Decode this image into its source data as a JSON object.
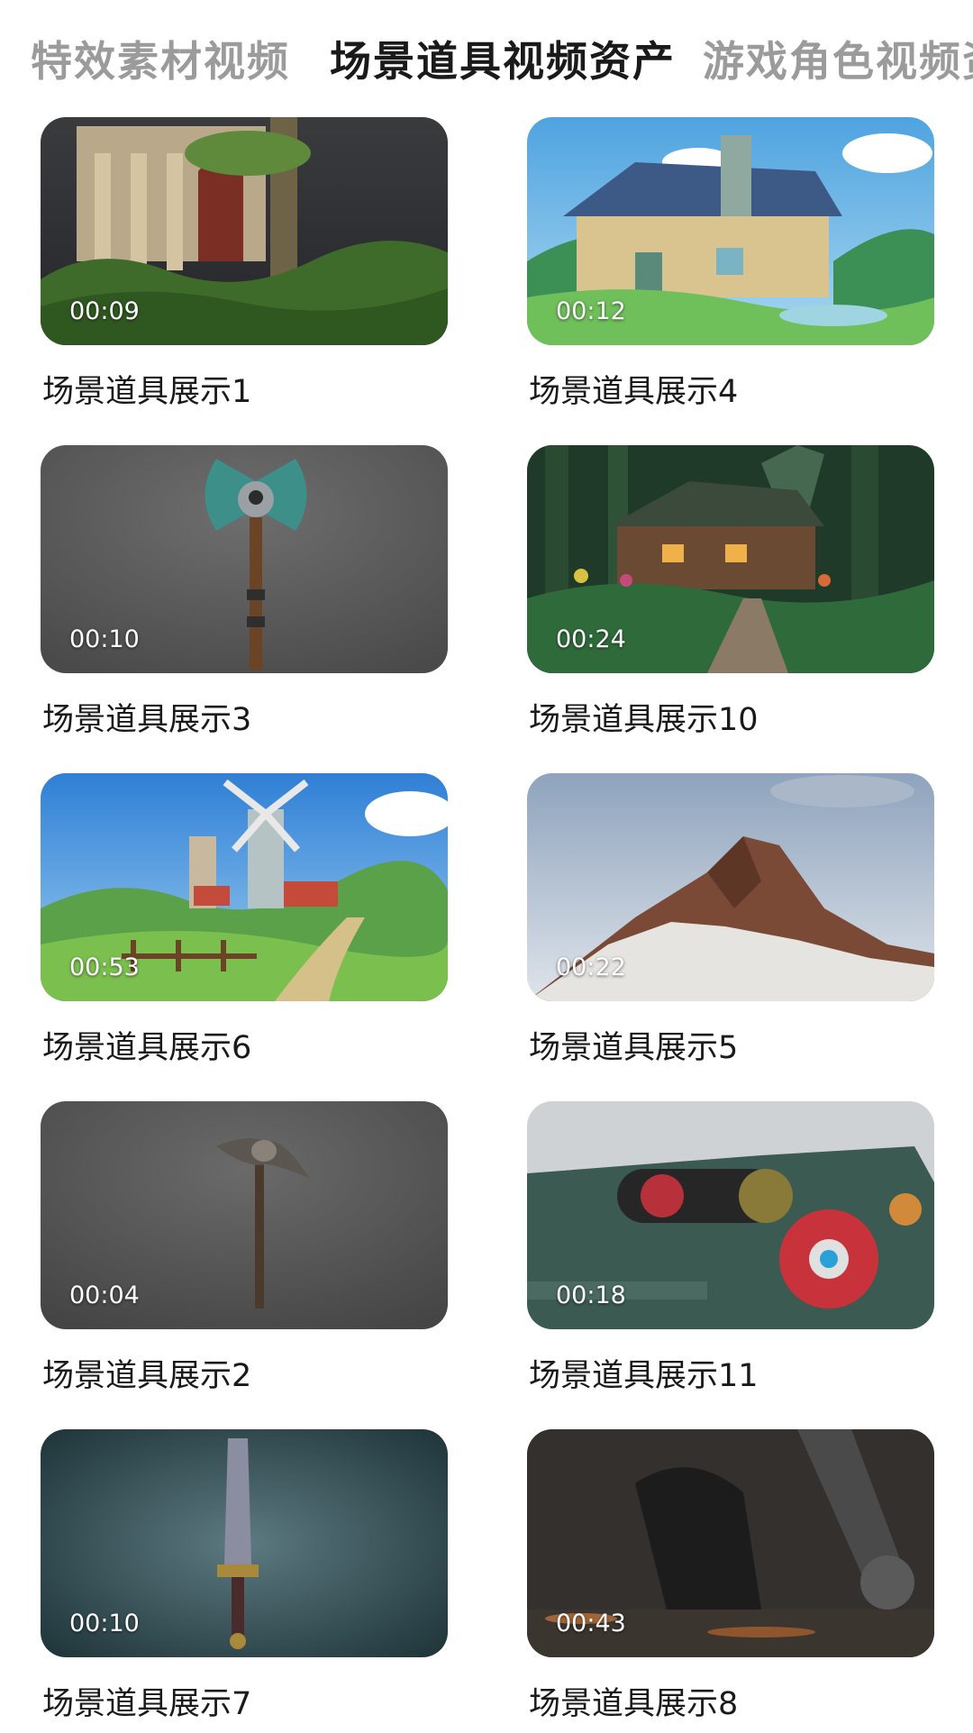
{
  "tabs": [
    {
      "label": "特效素材视频"
    },
    {
      "label": "场景道具视频资产"
    },
    {
      "label": "游戏角色视频资"
    }
  ],
  "items": [
    {
      "title": "场景道具展示1",
      "duration": "00:09",
      "thumb": "ruins-icon"
    },
    {
      "title": "场景道具展示4",
      "duration": "00:12",
      "thumb": "cottage-icon"
    },
    {
      "title": "场景道具展示3",
      "duration": "00:10",
      "thumb": "axe-icon"
    },
    {
      "title": "场景道具展示10",
      "duration": "00:24",
      "thumb": "forest-cabin-icon"
    },
    {
      "title": "场景道具展示6",
      "duration": "00:53",
      "thumb": "windmill-icon"
    },
    {
      "title": "场景道具展示5",
      "duration": "00:22",
      "thumb": "mountain-icon"
    },
    {
      "title": "场景道具展示2",
      "duration": "00:04",
      "thumb": "pickaxe-icon"
    },
    {
      "title": "场景道具展示11",
      "duration": "00:18",
      "thumb": "machine-icon"
    },
    {
      "title": "场景道具展示7",
      "duration": "00:10",
      "thumb": "sword-icon"
    },
    {
      "title": "场景道具展示8",
      "duration": "00:43",
      "thumb": "mech-icon"
    }
  ]
}
